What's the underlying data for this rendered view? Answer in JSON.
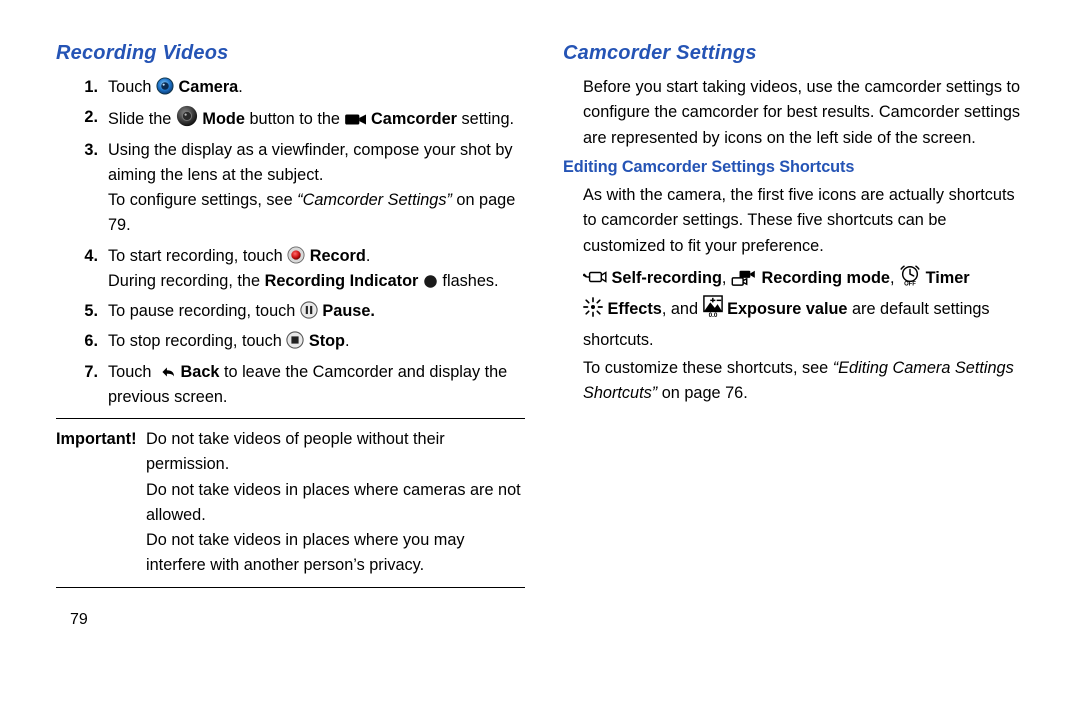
{
  "left": {
    "heading": "Recording Videos",
    "steps": [
      {
        "num": "1.",
        "pre": "Touch ",
        "icon": "camera",
        "post1": " ",
        "bold1": "Camera",
        "post2": "."
      },
      {
        "num": "2.",
        "pre": "Slide the ",
        "icon": "mode",
        "post1": " ",
        "bold1": "Mode",
        "post2": " button to the ",
        "icon2": "camcorder",
        "post3": " ",
        "bold2": "Camcorder",
        "post4": " setting."
      },
      {
        "num": "3.",
        "plain": "Using the display as a viewfinder, compose your shot by aiming the lens at the subject.",
        "sub_pre": "To configure settings, see ",
        "sub_ital": "“Camcorder Settings”",
        "sub_post": " on page 79."
      },
      {
        "num": "4.",
        "pre": "To start recording, touch ",
        "icon": "record",
        "post1": " ",
        "bold1": "Record",
        "post2": ".",
        "line2_pre": "During recording, the ",
        "line2_bold": "Recording Indicator",
        "line2_post1": " ",
        "line2_icon": "rec-indicator",
        "line2_post2": " flashes."
      },
      {
        "num": "5.",
        "pre": "To pause recording, touch ",
        "icon": "pause",
        "post1": " ",
        "bold1": "Pause.",
        "post2": ""
      },
      {
        "num": "6.",
        "pre": "To stop recording, touch ",
        "icon": "stop",
        "post1": " ",
        "bold1": "Stop",
        "post2": "."
      },
      {
        "num": "7.",
        "pre": "Touch ",
        "icon": "back",
        "post1": " ",
        "bold1": "Back",
        "post2": " to leave the Camcorder and display the previous screen."
      }
    ],
    "important_label": "Important!",
    "important_lines": [
      "Do not take videos of people without their permission.",
      "Do not take videos in places where cameras are not allowed.",
      "Do not take videos in places where you may interfere with another person’s privacy."
    ],
    "page_number": "79"
  },
  "right": {
    "heading": "Camcorder Settings",
    "intro": "Before you start taking videos, use the camcorder settings to configure the camcorder for best results. Camcorder settings are represented by icons on the left side of the screen.",
    "subheading": "Editing Camcorder Settings Shortcuts",
    "p1": "As with the camera, the first five icons are actually shortcuts to camcorder settings. These five shortcuts can be customized to fit your preference.",
    "shortcuts": {
      "self_recording": "Self-recording",
      "recording_mode": "Recording mode",
      "timer": "Timer",
      "effects": "Effects",
      "exposure_value": "Exposure value",
      "and_text": ", and ",
      "tail": " are default settings shortcuts."
    },
    "customize_pre": "To customize these shortcuts, see ",
    "customize_ital": "“Editing Camera Settings Shortcuts”",
    "customize_post": " on page 76."
  }
}
